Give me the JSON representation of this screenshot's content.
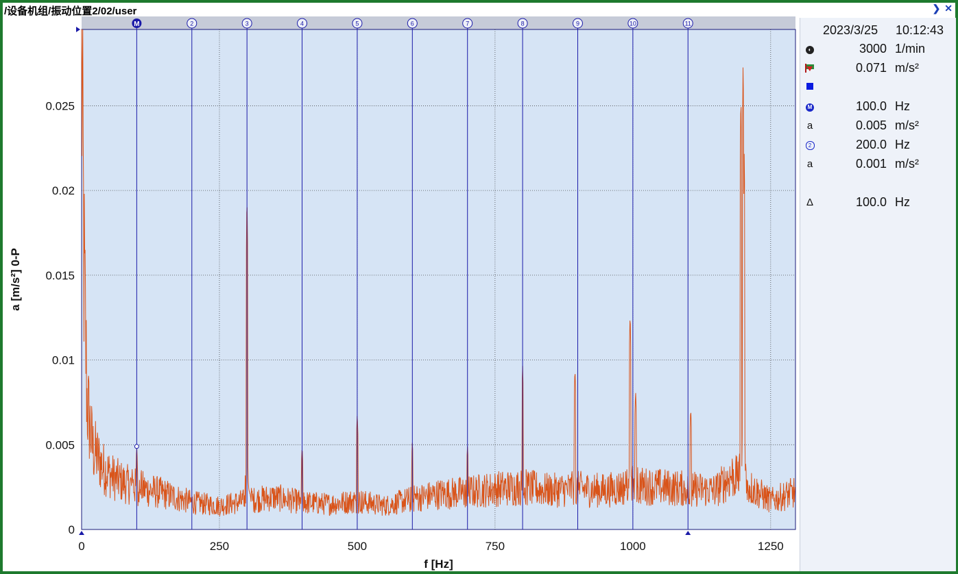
{
  "window": {
    "title": "/设备机组/振动位置2/02/user",
    "controls": [
      "❯",
      "✕"
    ]
  },
  "colors": {
    "background": "#1e7a2e",
    "plot_background": "#d6e4f5",
    "header_strip": "#c6cbd8",
    "spectrum": "#d9541a",
    "cursor_lines": "#1a1aa8",
    "grid": "#333333"
  },
  "info_panel": {
    "date": "2023/3/25",
    "time": "10:12:43",
    "rows": [
      {
        "icon": "rpm-icon",
        "value": "3000",
        "unit": "1/min"
      },
      {
        "icon": "overall-flag-icon",
        "value": "0.071",
        "unit": "m/s²"
      },
      {
        "icon": "square-marker-icon",
        "value": "",
        "unit": ""
      },
      {
        "icon": "main-cursor-icon",
        "value": "100.0",
        "unit": "Hz"
      },
      {
        "icon": "amplitude-icon",
        "label": "a",
        "value": "0.005",
        "unit": "m/s²"
      },
      {
        "icon": "harmonic-cursor-icon",
        "label": "2",
        "value": "200.0",
        "unit": "Hz"
      },
      {
        "icon": "amplitude-icon",
        "label": "a",
        "value": "0.001",
        "unit": "m/s²"
      },
      {
        "icon": "delta-icon",
        "label": "Δ",
        "value": "100.0",
        "unit": "Hz"
      }
    ]
  },
  "chart_data": {
    "type": "line",
    "title": "",
    "xlabel": "f [Hz]",
    "ylabel": "a [m/s²] 0-P",
    "xlim": [
      0,
      1295
    ],
    "ylim": [
      0,
      0.0295
    ],
    "x_ticks": [
      0,
      250,
      500,
      750,
      1000,
      1250
    ],
    "x_tick_labels": [
      "0",
      "250",
      "500",
      "750",
      "1000",
      "1250"
    ],
    "y_ticks": [
      0,
      0.005,
      0.01,
      0.015,
      0.02,
      0.025
    ],
    "y_tick_labels": [
      "0",
      "0.005",
      "0.01",
      "0.015",
      "0.02",
      "0.025"
    ],
    "grid": true,
    "series": [
      {
        "x_start": 0,
        "x_end": 1295,
        "baseline_points": [
          [
            0,
            0.029
          ],
          [
            4,
            0.016
          ],
          [
            10,
            0.0075
          ],
          [
            20,
            0.0048
          ],
          [
            40,
            0.0036
          ],
          [
            60,
            0.003
          ],
          [
            80,
            0.0027
          ],
          [
            100,
            0.0025
          ],
          [
            150,
            0.0021
          ],
          [
            200,
            0.0016
          ],
          [
            250,
            0.0014
          ],
          [
            300,
            0.0017
          ],
          [
            350,
            0.0019
          ],
          [
            400,
            0.0016
          ],
          [
            450,
            0.0015
          ],
          [
            500,
            0.0017
          ],
          [
            550,
            0.0014
          ],
          [
            600,
            0.0018
          ],
          [
            650,
            0.0021
          ],
          [
            700,
            0.0022
          ],
          [
            750,
            0.0024
          ],
          [
            800,
            0.0025
          ],
          [
            850,
            0.0023
          ],
          [
            900,
            0.0024
          ],
          [
            950,
            0.0023
          ],
          [
            1000,
            0.0026
          ],
          [
            1050,
            0.0025
          ],
          [
            1100,
            0.0024
          ],
          [
            1150,
            0.0023
          ],
          [
            1180,
            0.0032
          ],
          [
            1250,
            0.0017
          ],
          [
            1295,
            0.0022
          ]
        ],
        "peaks": [
          {
            "x": 100,
            "y": 0.0049
          },
          {
            "x": 300,
            "y": 0.0199
          },
          {
            "x": 400,
            "y": 0.0049
          },
          {
            "x": 500,
            "y": 0.0069
          },
          {
            "x": 600,
            "y": 0.0052
          },
          {
            "x": 700,
            "y": 0.0049
          },
          {
            "x": 800,
            "y": 0.0098
          },
          {
            "x": 895,
            "y": 0.0096
          },
          {
            "x": 995,
            "y": 0.0129
          },
          {
            "x": 1005,
            "y": 0.0083
          },
          {
            "x": 1105,
            "y": 0.0072
          },
          {
            "x": 1196,
            "y": 0.0261
          },
          {
            "x": 1200,
            "y": 0.0281
          },
          {
            "x": 1202,
            "y": 0.0225
          }
        ]
      }
    ],
    "cursors": {
      "main": {
        "x": 100,
        "label": "M",
        "y_marker": 0.0049
      },
      "harmonics": [
        {
          "x": 200,
          "label": "2"
        },
        {
          "x": 300,
          "label": "3"
        },
        {
          "x": 400,
          "label": "4"
        },
        {
          "x": 500,
          "label": "5"
        },
        {
          "x": 600,
          "label": "6"
        },
        {
          "x": 700,
          "label": "7"
        },
        {
          "x": 800,
          "label": "8"
        },
        {
          "x": 900,
          "label": "9"
        },
        {
          "x": 1000,
          "label": "10"
        },
        {
          "x": 1100,
          "label": "11"
        }
      ]
    }
  }
}
